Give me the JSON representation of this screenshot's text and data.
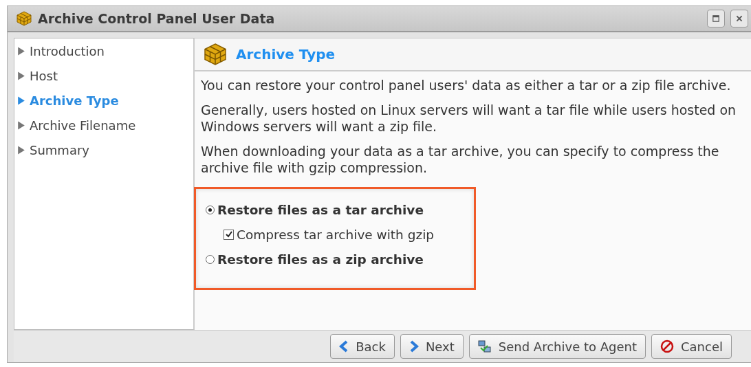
{
  "window": {
    "title": "Archive Control Panel User Data"
  },
  "sidebar": {
    "items": [
      {
        "label": "Introduction",
        "selected": false
      },
      {
        "label": "Host",
        "selected": false
      },
      {
        "label": "Archive Type",
        "selected": true
      },
      {
        "label": "Archive Filename",
        "selected": false
      },
      {
        "label": "Summary",
        "selected": false
      }
    ]
  },
  "page": {
    "title": "Archive Type",
    "paragraphs": [
      "You can restore your control panel users' data as either a tar or a zip file archive.",
      "Generally, users hosted on Linux servers will want a tar file while users hosted on Windows servers will want a zip file.",
      "When downloading your data as a tar archive, you can specify to compress the archive file with gzip compression."
    ],
    "options": [
      {
        "kind": "radio",
        "label": "Restore files as a tar archive",
        "selected": true
      },
      {
        "kind": "checkbox",
        "label": "Compress tar archive with gzip",
        "checked": true
      },
      {
        "kind": "radio",
        "label": "Restore files as a zip archive",
        "selected": false
      }
    ],
    "highlighted": true
  },
  "buttons": [
    {
      "kind": "back",
      "label": "Back"
    },
    {
      "kind": "next",
      "label": "Next"
    },
    {
      "kind": "send",
      "label": "Send Archive to Agent"
    },
    {
      "kind": "cancel",
      "label": "Cancel"
    }
  ]
}
